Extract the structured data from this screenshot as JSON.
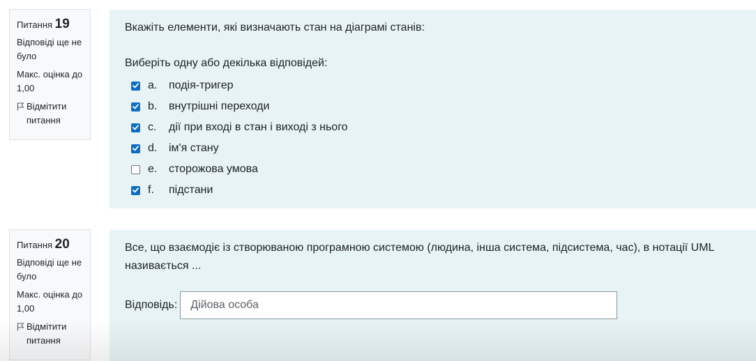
{
  "questions": [
    {
      "label": "Питання",
      "number": "19",
      "state": "Відповіді ще не було",
      "grade": "Макс. оцінка до 1,00",
      "flag_label": "Відмітити питання",
      "text": "Вкажіть елементи, які визначають стан на діаграмі станів:",
      "prompt": "Виберіть одну або декілька відповідей:",
      "options": [
        {
          "letter": "a.",
          "text": "подія-тригер",
          "checked": true
        },
        {
          "letter": "b.",
          "text": "внутрішні переходи",
          "checked": true
        },
        {
          "letter": "c.",
          "text": "дії при вході в стан і виході з нього",
          "checked": true
        },
        {
          "letter": "d.",
          "text": "ім'я стану",
          "checked": true
        },
        {
          "letter": "e.",
          "text": "сторожова умова",
          "checked": false
        },
        {
          "letter": "f.",
          "text": "підстани",
          "checked": true
        }
      ]
    },
    {
      "label": "Питання",
      "number": "20",
      "state": "Відповіді ще не було",
      "grade": "Макс. оцінка до 1,00",
      "flag_label": "Відмітити питання",
      "text": "Все, що взаємодіє із створюваною програмною системою (людина, інша система, підсистема, час), в нотації UML називається ...",
      "answer_label": "Відповідь:",
      "answer_value": "Дійова особа"
    }
  ],
  "colors": {
    "content_bg": "#e7f3f5",
    "info_bg": "#f8f9fa",
    "checkbox_accent": "#0f6cbf"
  },
  "icons": {
    "flag": "flag-icon",
    "checkbox_tick": "check-icon"
  }
}
